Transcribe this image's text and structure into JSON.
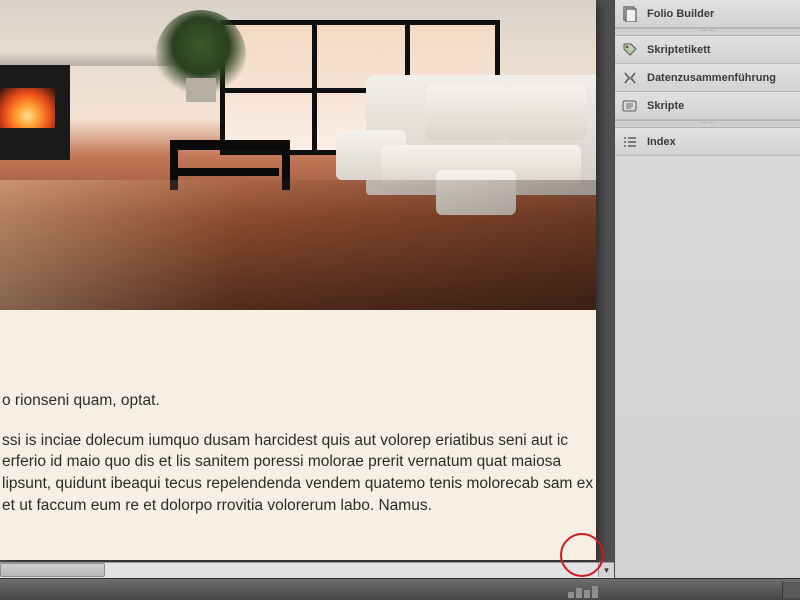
{
  "panels": {
    "items": [
      {
        "label": "Folio Builder",
        "icon": "folio"
      },
      {
        "label": "Skriptetikett",
        "icon": "tag"
      },
      {
        "label": "Datenzusammenführung",
        "icon": "merge"
      },
      {
        "label": "Skripte",
        "icon": "script"
      },
      {
        "label": "Index",
        "icon": "index"
      }
    ]
  },
  "document": {
    "paragraph1": "o rionseni quam, optat.",
    "paragraph2": "ssi is inciae dolecum iumquo dusam harcidest quis aut volorep eriatibus seni aut ic erferio id maio quo dis et lis sanitem poressi molorae prerit vernatum quat maiosa lipsunt, quidunt ibeaqui tecus repelendenda vendem quatemo tenis molorecab sam ex et ut faccum eum re et dolorpo rrovitia volorerum labo. Namus."
  },
  "colors": {
    "annotation": "#d01820"
  }
}
